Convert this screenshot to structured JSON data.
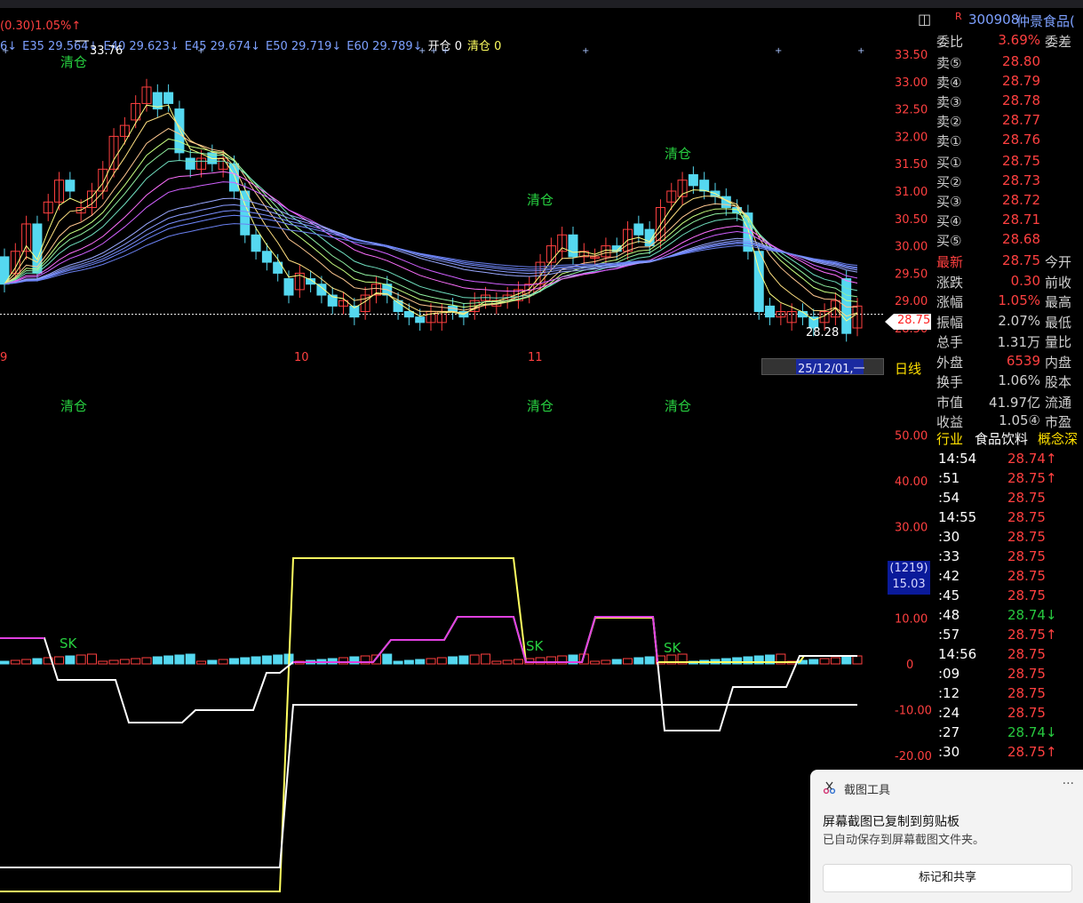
{
  "header": {
    "info": "(0.30)1.05%↑",
    "ma_legend": [
      {
        "text": "6↓",
        "color": "#7da0ff"
      },
      {
        "text": "E35 29.564↓",
        "color": "#7da0ff"
      },
      {
        "text": "E40 29.623↓",
        "color": "#7da0ff"
      },
      {
        "text": "E45 29.674↓",
        "color": "#7da0ff"
      },
      {
        "text": "E50 29.719↓",
        "color": "#7da0ff"
      },
      {
        "text": "E60 29.789↓",
        "color": "#7da0ff"
      },
      {
        "text": "开仓 0",
        "color": "#ffffff"
      },
      {
        "text": "清仓 0",
        "color": "#ffff60"
      }
    ]
  },
  "main_chart": {
    "price_ticks": [
      "33.50",
      "33.00",
      "32.50",
      "32.00",
      "31.50",
      "31.00",
      "30.50",
      "30.00",
      "29.50",
      "29.00",
      "28.50"
    ],
    "high_label": "33.76",
    "low_label": "28.28",
    "current_price_tag": "28.75",
    "month_labels": [
      "9",
      "10",
      "11"
    ],
    "signal_label": "清仓",
    "date_cursor": "25/12/01,一",
    "period": "日线"
  },
  "indicator": {
    "ticks": [
      "50.00",
      "40.00",
      "30.00",
      "10.00",
      "0",
      "-10.00",
      "-20.00"
    ],
    "signal_top": "清仓",
    "sk_label": "SK",
    "badge_top": "(1219)",
    "badge_bottom": "15.03"
  },
  "chart_data": {
    "type": "line",
    "title": "",
    "xlabel": "",
    "ylabel": "",
    "ylim": [
      28.5,
      33.5
    ],
    "series": [
      {
        "name": "E35",
        "values": [
          29.564
        ]
      },
      {
        "name": "E40",
        "values": [
          29.623
        ]
      },
      {
        "name": "E45",
        "values": [
          29.674
        ]
      },
      {
        "name": "E50",
        "values": [
          29.719
        ]
      },
      {
        "name": "E60",
        "values": [
          29.789
        ]
      }
    ]
  },
  "panel": {
    "code": "300908",
    "name": "仲景食品(",
    "r_label": "R",
    "weibi": {
      "label": "委比",
      "value": "3.69%",
      "ext": "委差"
    },
    "asks": [
      {
        "label": "卖⑤",
        "price": "28.80"
      },
      {
        "label": "卖④",
        "price": "28.79"
      },
      {
        "label": "卖③",
        "price": "28.78"
      },
      {
        "label": "卖②",
        "price": "28.77"
      },
      {
        "label": "卖①",
        "price": "28.76"
      }
    ],
    "bids": [
      {
        "label": "买①",
        "price": "28.75"
      },
      {
        "label": "买②",
        "price": "28.73"
      },
      {
        "label": "买③",
        "price": "28.72"
      },
      {
        "label": "买④",
        "price": "28.71"
      },
      {
        "label": "买⑤",
        "price": "28.68"
      }
    ],
    "stats": [
      {
        "label": "最新",
        "value": "28.75",
        "ext": "今开",
        "lc": "#ff4040",
        "vc": "#ff4040"
      },
      {
        "label": "涨跌",
        "value": "0.30",
        "ext": "前收",
        "lc": "#d0d0d0",
        "vc": "#ff4040"
      },
      {
        "label": "涨幅",
        "value": "1.05%",
        "ext": "最高",
        "lc": "#d0d0d0",
        "vc": "#ff4040"
      },
      {
        "label": "振幅",
        "value": "2.07%",
        "ext": "最低",
        "lc": "#d0d0d0",
        "vc": "#d0d0d0"
      },
      {
        "label": "总手",
        "value": "1.31万",
        "ext": "量比",
        "lc": "#d0d0d0",
        "vc": "#d0d0d0"
      },
      {
        "label": "外盘",
        "value": "6539",
        "ext": "内盘",
        "lc": "#d0d0d0",
        "vc": "#ff4040"
      },
      {
        "label": "换手",
        "value": "1.06%",
        "ext": "股本",
        "lc": "#d0d0d0",
        "vc": "#d0d0d0"
      },
      {
        "label": "市值",
        "value": "41.97亿",
        "ext": "流通",
        "lc": "#d0d0d0",
        "vc": "#d0d0d0"
      },
      {
        "label": "收益",
        "value": "1.05④",
        "ext": "市盈",
        "lc": "#d0d0d0",
        "vc": "#d0d0d0"
      }
    ],
    "industry": {
      "label": "行业",
      "value": "食品饮料",
      "ext": "概念深"
    },
    "ticks": [
      {
        "time": "14:54",
        "price": "28.74↑",
        "c": "#ff4040"
      },
      {
        "time": ":51",
        "price": "28.75↑",
        "c": "#ff4040"
      },
      {
        "time": ":54",
        "price": "28.75",
        "c": "#ff4040"
      },
      {
        "time": "14:55",
        "price": "28.75",
        "c": "#ff4040"
      },
      {
        "time": ":30",
        "price": "28.75",
        "c": "#ff4040"
      },
      {
        "time": ":33",
        "price": "28.75",
        "c": "#ff4040"
      },
      {
        "time": ":42",
        "price": "28.75",
        "c": "#ff4040"
      },
      {
        "time": ":45",
        "price": "28.75",
        "c": "#ff4040"
      },
      {
        "time": ":48",
        "price": "28.74↓",
        "c": "#27c93f"
      },
      {
        "time": ":57",
        "price": "28.75↑",
        "c": "#ff4040"
      },
      {
        "time": "14:56",
        "price": "28.75",
        "c": "#ff4040"
      },
      {
        "time": ":09",
        "price": "28.75",
        "c": "#ff4040"
      },
      {
        "time": ":12",
        "price": "28.75",
        "c": "#ff4040"
      },
      {
        "time": ":24",
        "price": "28.75",
        "c": "#ff4040"
      },
      {
        "time": ":27",
        "price": "28.74↓",
        "c": "#27c93f"
      },
      {
        "time": ":30",
        "price": "28.75↑",
        "c": "#ff4040"
      }
    ]
  },
  "toast": {
    "app": "截图工具",
    "more": "···",
    "message": "屏幕截图已复制到剪贴板",
    "sub": "已自动保存到屏幕截图文件夹。",
    "action": "标记和共享"
  }
}
